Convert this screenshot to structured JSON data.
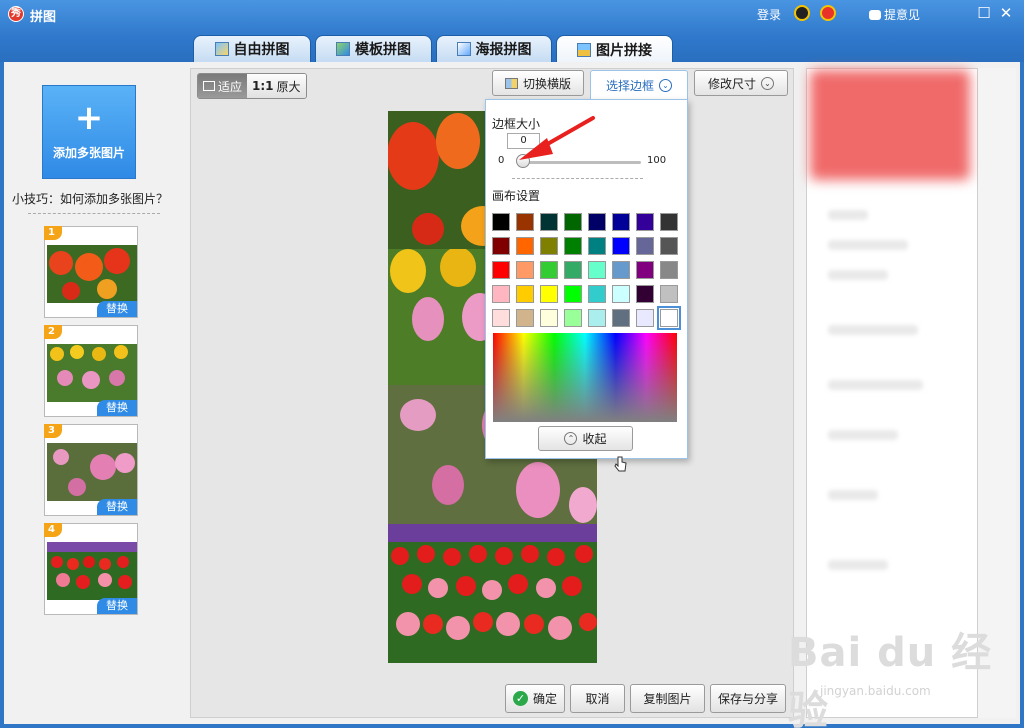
{
  "app": {
    "title": "拼图",
    "logo_text": "秀"
  },
  "titlebar": {
    "login": "登录",
    "feedback": "提意见",
    "minimize": "☐",
    "close": "✕"
  },
  "tabs": [
    {
      "label": "自由拼图"
    },
    {
      "label": "模板拼图"
    },
    {
      "label": "海报拼图"
    },
    {
      "label": "图片拼接"
    }
  ],
  "left": {
    "add_plus": "+",
    "add_label": "添加多张图片",
    "tip": "小技巧：如何添加多张图片？",
    "thumbs": [
      {
        "num": "1",
        "replace": "替换"
      },
      {
        "num": "2",
        "replace": "替换"
      },
      {
        "num": "3",
        "replace": "替换"
      },
      {
        "num": "4",
        "replace": "替换"
      }
    ]
  },
  "toolbar": {
    "fit": "适应",
    "original_icon": "1:1",
    "original": "原大",
    "switch_layout": "切换横版",
    "select_border": "选择边框",
    "resize": "修改尺寸"
  },
  "border_popup": {
    "size_label": "边框大小",
    "value": "0",
    "min": "0",
    "max": "100",
    "level_fraction": 0,
    "canvas_label": "画布设置",
    "swatches": [
      [
        "#000000",
        "#993300",
        "#003333",
        "#006600",
        "#000066",
        "#000099",
        "#330099",
        "#333333"
      ],
      [
        "#800000",
        "#ff6600",
        "#808000",
        "#008000",
        "#008080",
        "#0000ff",
        "#666699",
        "#555555"
      ],
      [
        "#ff0000",
        "#ff9966",
        "#33cc33",
        "#33aa66",
        "#66ffcc",
        "#6699cc",
        "#800080",
        "#888888"
      ],
      [
        "#ffb6c1",
        "#ffcc00",
        "#ffff00",
        "#00ff00",
        "#33cccc",
        "#ccffff",
        "#330033",
        "#c0c0c0"
      ],
      [
        "#ffdddd",
        "#d2b48c",
        "#ffffdd",
        "#99ff99",
        "#aaeeee",
        "#607080",
        "#e8e8ff",
        "#ffffff"
      ]
    ],
    "collapse": "收起"
  },
  "bottom": {
    "confirm": "确定",
    "cancel": "取消",
    "copy": "复制图片",
    "save_share": "保存与分享"
  },
  "watermark": {
    "main": "Bai du 经验",
    "sub": "jingyan.baidu.com"
  }
}
